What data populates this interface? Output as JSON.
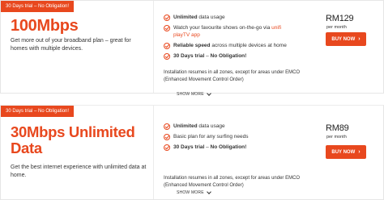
{
  "plans": [
    {
      "promo": "30 Days trial – No Obligation!",
      "title_line1": "100Mbps",
      "title_line2": "",
      "description": "Get more out of your broadband plan – great for homes with multiple devices.",
      "features": [
        {
          "bold": "Unlimited",
          "text": " data usage",
          "link": "",
          "text_after": ""
        },
        {
          "bold": "",
          "text": "Watch your favourite shows on-the-go via ",
          "link": "unifi playTV app",
          "text_after": ""
        },
        {
          "bold": "Reliable speed",
          "text": " across multiple devices at home",
          "link": "",
          "text_after": ""
        },
        {
          "bold": "30 Days trial",
          "text": " – ",
          "link": "",
          "text_after": "No Obligation!"
        }
      ],
      "note": "Installation resumes in all zones, except for areas under EMCO (Enhanced Movement Control Order)",
      "price": "RM129",
      "period": "per month",
      "buy_label": "BUY NOW",
      "show_more": "SHOW MORE"
    },
    {
      "promo": "30 Days trial – No Obligation!",
      "title_line1": "30Mbps Unlimited",
      "title_line2": "Data",
      "description": "Get the best internet experience with unlimited data at home.",
      "features": [
        {
          "bold": "Unlimited",
          "text": " data usage",
          "link": "",
          "text_after": ""
        },
        {
          "bold": "",
          "text": "Basic plan for any surfing needs",
          "link": "",
          "text_after": ""
        },
        {
          "bold": "30 Days trial",
          "text": " – ",
          "link": "",
          "text_after": "No Obligation!"
        }
      ],
      "note": "Installation resumes in all zones, except for areas under EMCO (Enhanced Movement Control Order)",
      "price": "RM89",
      "period": "per month",
      "buy_label": "BUY NOW",
      "show_more": "SHOW MORE"
    }
  ],
  "colors": {
    "accent": "#e8481e",
    "text": "#333333"
  },
  "icons": {
    "feature": "check-circle-icon",
    "buy": "chevron-right-icon",
    "show_more": "chevron-down-icon"
  }
}
